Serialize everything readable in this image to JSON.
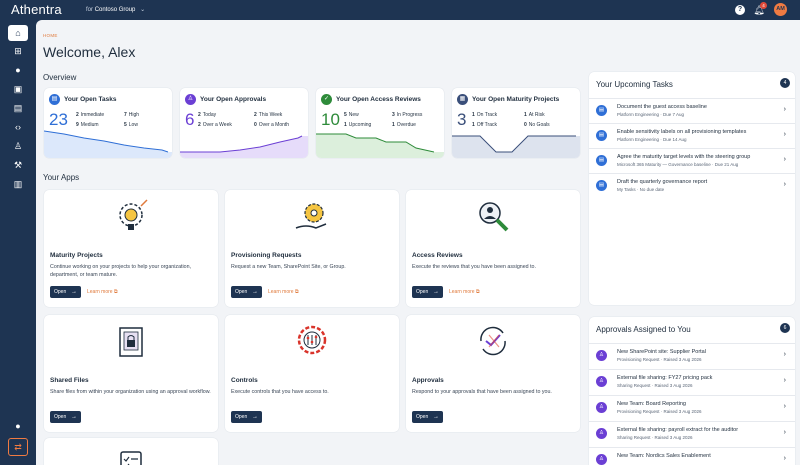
{
  "topbar": {
    "brand": "Athentra",
    "tenant_prefix": "for",
    "tenant_name": "Contoso Group",
    "notifications_count": "4",
    "avatar_initials": "AM"
  },
  "breadcrumb": "HOME",
  "welcome": "Welcome, Alex",
  "overview_title": "Overview",
  "stats": [
    {
      "title": "Your Open Tasks",
      "big": "23",
      "color": "#2f6fd6",
      "kv": [
        [
          "2",
          "Immediate"
        ],
        [
          "7",
          "High"
        ],
        [
          "9",
          "Medium"
        ],
        [
          "5",
          "Low"
        ]
      ]
    },
    {
      "title": "Your Open Approvals",
      "big": "6",
      "color": "#6b3fd4",
      "kv": [
        [
          "2",
          "Today"
        ],
        [
          "2",
          "This Week"
        ],
        [
          "2",
          "Over a Week"
        ],
        [
          "0",
          "Over a Month"
        ]
      ]
    },
    {
      "title": "Your Open Access Reviews",
      "big": "10",
      "color": "#2e8b3a",
      "kv": [
        [
          "5",
          "New"
        ],
        [
          "3",
          "In Progress"
        ],
        [
          "1",
          "Upcoming"
        ],
        [
          "1",
          "Overdue"
        ]
      ]
    },
    {
      "title": "Your Open Maturity Projects",
      "big": "3",
      "color": "#3a4f7a",
      "kv": [
        [
          "1",
          "On Track"
        ],
        [
          "1",
          "At Risk"
        ],
        [
          "1",
          "Off Track"
        ],
        [
          "0",
          "No Goals"
        ]
      ]
    }
  ],
  "apps_title": "Your Apps",
  "apps": [
    {
      "name": "Maturity Projects",
      "desc": "Continue working on your projects to help your organization, department, or team mature.",
      "open": "Open",
      "more": "Learn more"
    },
    {
      "name": "Provisioning Requests",
      "desc": "Request a new Team, SharePoint Site, or Group.",
      "open": "Open",
      "more": "Learn more"
    },
    {
      "name": "Access Reviews",
      "desc": "Execute the reviews that you have been assigned to.",
      "open": "Open",
      "more": "Learn more"
    },
    {
      "name": "Shared Files",
      "desc": "Share files from within your organization using an approval workflow.",
      "open": "Open"
    },
    {
      "name": "Controls",
      "desc": "Execute controls that you have access to.",
      "open": "Open"
    },
    {
      "name": "Approvals",
      "desc": "Respond to your approvals that have been assigned to you.",
      "open": "Open"
    }
  ],
  "tasks_panel": {
    "title": "Your Upcoming Tasks",
    "count": "4",
    "items": [
      {
        "title": "Document the guest access baseline",
        "sub": "Platform Engineering · Due 7 Aug"
      },
      {
        "title": "Enable sensitivity labels on all provisioning templates",
        "sub": "Platform Engineering · Due 14 Aug"
      },
      {
        "title": "Agree the maturity target levels with the steering group",
        "sub": "Microsoft 365 Maturity — Governance baseline · Due 21 Aug"
      },
      {
        "title": "Draft the quarterly governance report",
        "sub": "My Tasks · No due date"
      }
    ]
  },
  "approvals_panel": {
    "title": "Approvals Assigned to You",
    "count": "6",
    "items": [
      {
        "title": "New SharePoint site: Supplier Portal",
        "sub": "Provisioning Request · Raised 3 Aug 2026"
      },
      {
        "title": "External file sharing: FY27 pricing pack",
        "sub": "Sharing Request · Raised 3 Aug 2026"
      },
      {
        "title": "New Team: Board Reporting",
        "sub": "Provisioning Request · Raised 3 Aug 2026"
      },
      {
        "title": "External file sharing: payroll extract for the auditor",
        "sub": "Sharing Request · Raised 3 Aug 2026"
      },
      {
        "title": "New Team: Nordics Sales Enablement",
        "sub": ""
      }
    ]
  },
  "colors": {
    "navy": "#1e3452",
    "accent": "#f07b42",
    "task_blue": "#2f6fd6",
    "approval_purple": "#6b3fd4"
  }
}
